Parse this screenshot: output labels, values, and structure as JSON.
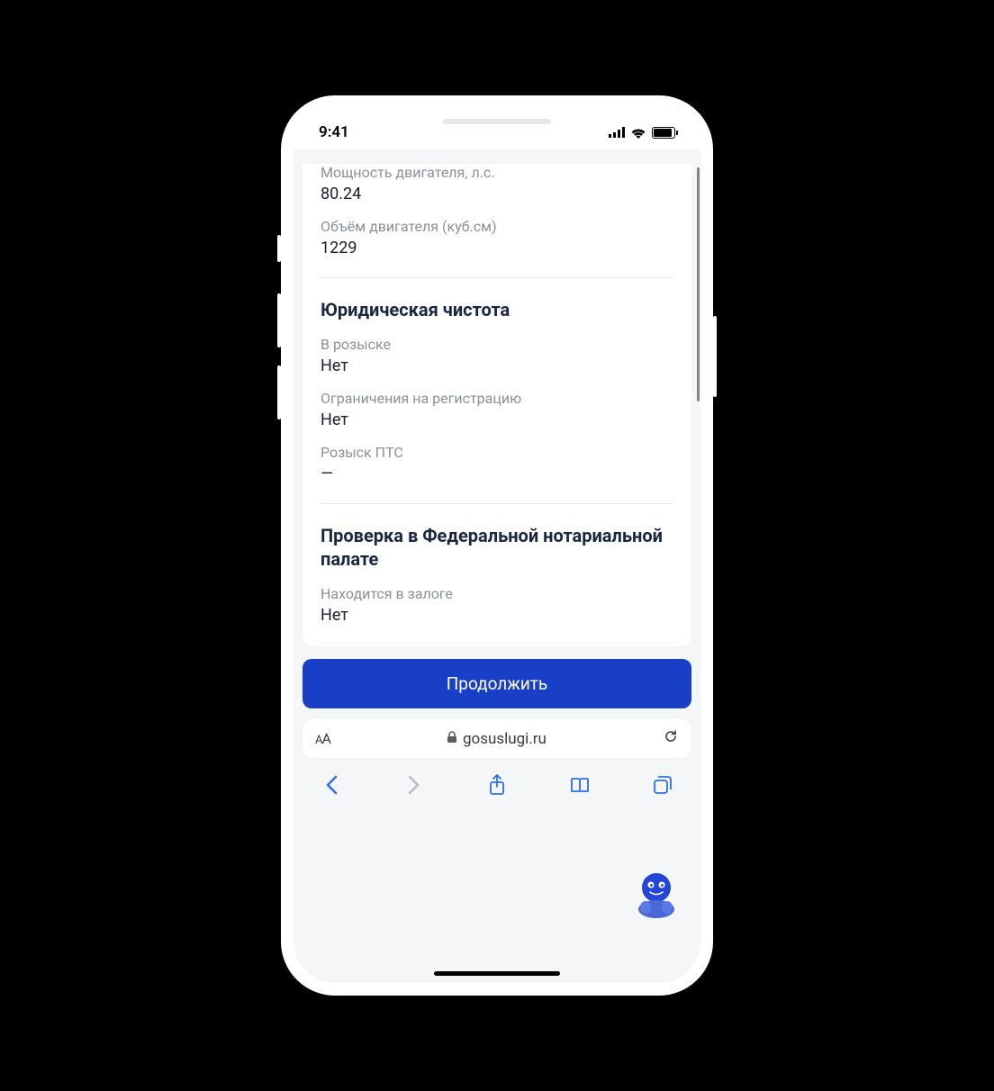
{
  "status": {
    "time": "9:41"
  },
  "engine": {
    "power_label": "Мощность двигателя, л.с.",
    "power_value": "80.24",
    "volume_label": "Объём двигателя (куб.см)",
    "volume_value": "1229"
  },
  "legal": {
    "title": "Юридическая чистота",
    "wanted_label": "В розыске",
    "wanted_value": "Нет",
    "restrictions_label": "Ограничения на регистрацию",
    "restrictions_value": "Нет",
    "pts_label": "Розыск ПТС",
    "pts_value": "—"
  },
  "notary": {
    "title": "Проверка в Федеральной нотариальной палате",
    "pledge_label": "Находится в залоге",
    "pledge_value": "Нет"
  },
  "actions": {
    "continue_label": "Продолжить"
  },
  "browser": {
    "url": "gosuslugi.ru"
  }
}
